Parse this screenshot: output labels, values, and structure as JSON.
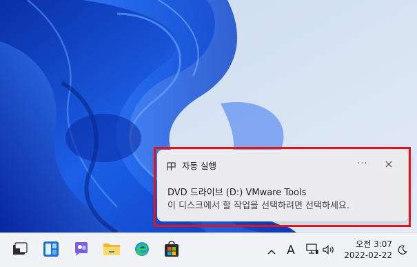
{
  "notification": {
    "app_name": "자동 실행",
    "more_label": "···",
    "title": "DVD 드라이브 (D:) VMware Tools",
    "body": "이 디스크에서 할 작업을 선택하려면 선택하세요.",
    "icons": {
      "app": "autoplay-icon",
      "close": "close-icon"
    }
  },
  "taskbar": {
    "apps": [
      {
        "name": "Start",
        "icon": "start-icon"
      },
      {
        "name": "Widgets",
        "icon": "widgets-icon"
      },
      {
        "name": "Chat",
        "icon": "chat-icon"
      },
      {
        "name": "File Explorer",
        "icon": "folder-icon"
      },
      {
        "name": "Microsoft Edge",
        "icon": "edge-icon"
      },
      {
        "name": "Microsoft Store",
        "icon": "store-icon"
      }
    ],
    "tray": {
      "chevron": "chevron-up-icon",
      "ime_label": "A",
      "network": "network-icon",
      "volume": "volume-icon"
    },
    "clock": {
      "time": "오전 3:07",
      "date": "2022-02-22"
    },
    "focus_assist": "moon-icon"
  },
  "colors": {
    "highlight": "#e0141a",
    "wallpaper_blue": "#1b5fe0",
    "toast_bg": "#ecebee",
    "taskbar_bg": "#f0f2f5"
  }
}
